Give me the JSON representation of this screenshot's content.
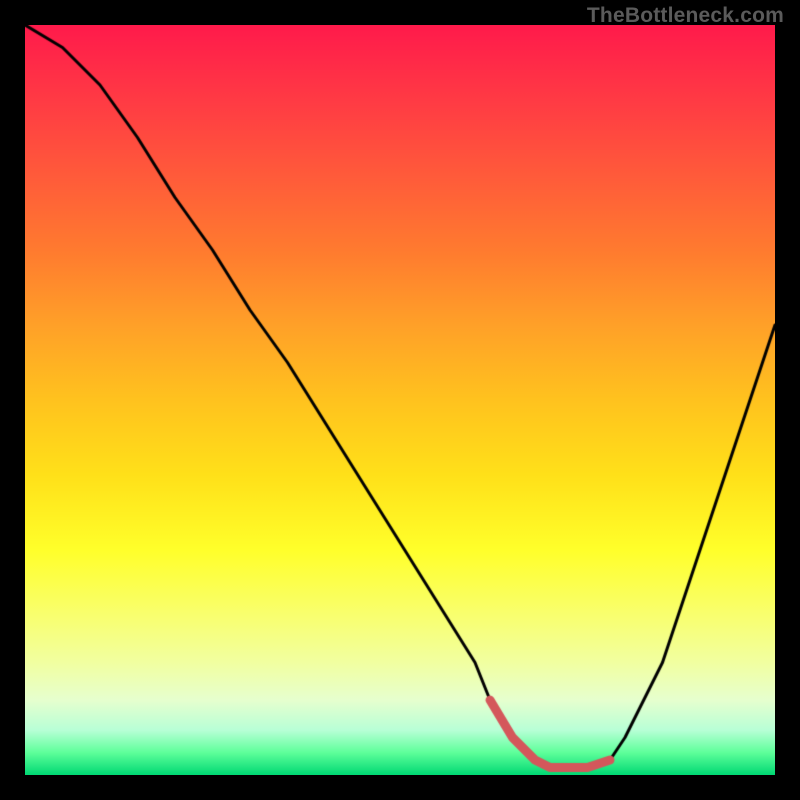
{
  "watermark": "TheBottleneck.com",
  "colors": {
    "background": "#000000",
    "curve": "#000000",
    "highlight": "#d4575b",
    "watermark": "#5b5b5b"
  },
  "chart_data": {
    "type": "line",
    "title": "",
    "xlabel": "",
    "ylabel": "",
    "xlim": [
      0,
      100
    ],
    "ylim": [
      0,
      100
    ],
    "x": [
      0,
      5,
      10,
      15,
      20,
      25,
      30,
      35,
      40,
      45,
      50,
      55,
      60,
      62,
      65,
      68,
      70,
      72,
      75,
      78,
      80,
      85,
      90,
      95,
      100
    ],
    "values": [
      100,
      97,
      92,
      85,
      77,
      70,
      62,
      55,
      47,
      39,
      31,
      23,
      15,
      10,
      5,
      2,
      1,
      1,
      1,
      2,
      5,
      15,
      30,
      45,
      60
    ],
    "highlight_range_x": [
      62,
      78
    ],
    "note": "Values are read from the vertical gradient: 0 = bottom (green), 100 = top (red). No axis labels or ticks are rendered in the source image; x and y are normalized 0–100."
  }
}
